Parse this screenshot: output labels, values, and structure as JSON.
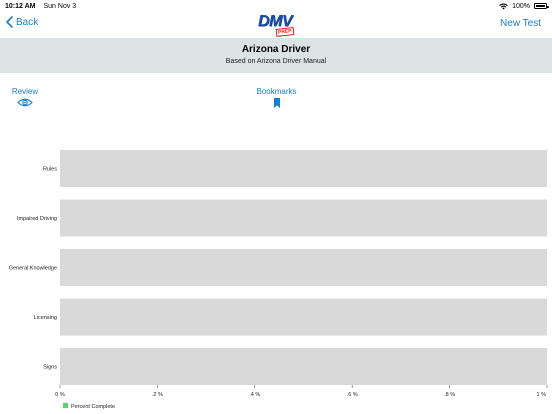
{
  "status_bar": {
    "time": "10:12 AM",
    "date": "Sun Nov 3",
    "battery": "100%"
  },
  "nav": {
    "back_label": "Back",
    "new_test_label": "New Test",
    "logo_text": "DMV",
    "logo_badge": "PREP"
  },
  "header": {
    "title": "Arizona Driver",
    "subtitle": "Based on Arizona Driver Manual"
  },
  "toolbar": {
    "review_label": "Review",
    "review_icon": "eye-icon",
    "bookmarks_label": "Bookmarks",
    "bookmarks_icon": "bookmark-icon"
  },
  "colors": {
    "accent": "#1a7fd1",
    "header_band": "#dce3e4",
    "bar_track": "#d9d9d9",
    "legend_green": "#4cd964"
  },
  "chart_data": {
    "type": "bar",
    "orientation": "horizontal",
    "categories": [
      "Rules",
      "Impaired Driving",
      "General Knowledge",
      "Licensing",
      "Signs"
    ],
    "series": [
      {
        "name": "Percent Complete",
        "values": [
          0,
          0,
          0,
          0,
          0
        ]
      }
    ],
    "xlim": [
      0,
      1
    ],
    "x_ticks": [
      "0 %",
      ".2 %",
      ".4 %",
      ".6 %",
      ".8 %",
      "1 %"
    ],
    "legend_placement": "bottom-left"
  }
}
